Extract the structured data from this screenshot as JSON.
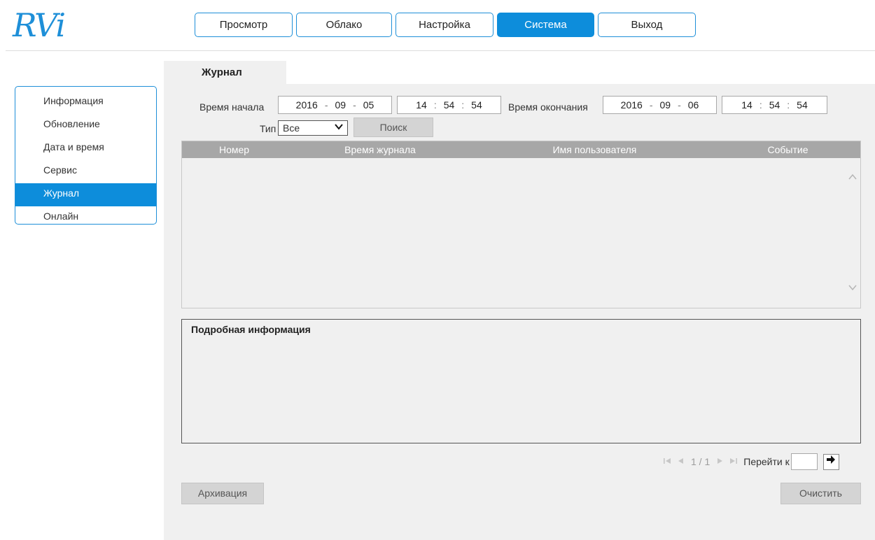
{
  "logo": {
    "text": "RVi"
  },
  "nav": {
    "items": [
      {
        "label": "Просмотр"
      },
      {
        "label": "Облако"
      },
      {
        "label": "Настройка"
      },
      {
        "label": "Система"
      },
      {
        "label": "Выход"
      }
    ],
    "active": "Система"
  },
  "sidebar": {
    "items": [
      {
        "label": "Информация"
      },
      {
        "label": "Обновление"
      },
      {
        "label": "Дата и время"
      },
      {
        "label": "Сервис"
      },
      {
        "label": "Журнал"
      },
      {
        "label": "Онлайн"
      }
    ],
    "active": "Журнал"
  },
  "tab": {
    "title": "Журнал"
  },
  "filters": {
    "start_label": "Время начала",
    "start_date": {
      "y": "2016",
      "m": "09",
      "d": "05"
    },
    "start_time": {
      "h": "14",
      "m": "54",
      "s": "54"
    },
    "end_label": "Время окончания",
    "end_date": {
      "y": "2016",
      "m": "09",
      "d": "06"
    },
    "end_time": {
      "h": "14",
      "m": "54",
      "s": "54"
    },
    "date_sep": "-",
    "time_sep": ":",
    "type_label": "Тип",
    "type_value": "Все",
    "search_label": "Поиск"
  },
  "table": {
    "columns": [
      "Номер",
      "Время журнала",
      "Имя пользователя",
      "Событие"
    ],
    "rows": []
  },
  "details": {
    "title": "Подробная информация"
  },
  "pager": {
    "count": "1 / 1",
    "goto_label": "Перейти к",
    "goto_value": ""
  },
  "buttons": {
    "backup": "Архивация",
    "clear": "Очистить"
  },
  "colors": {
    "accent": "#0d8ddb",
    "panel": "#f0f0f0",
    "table_header": "#a7a7a7"
  }
}
